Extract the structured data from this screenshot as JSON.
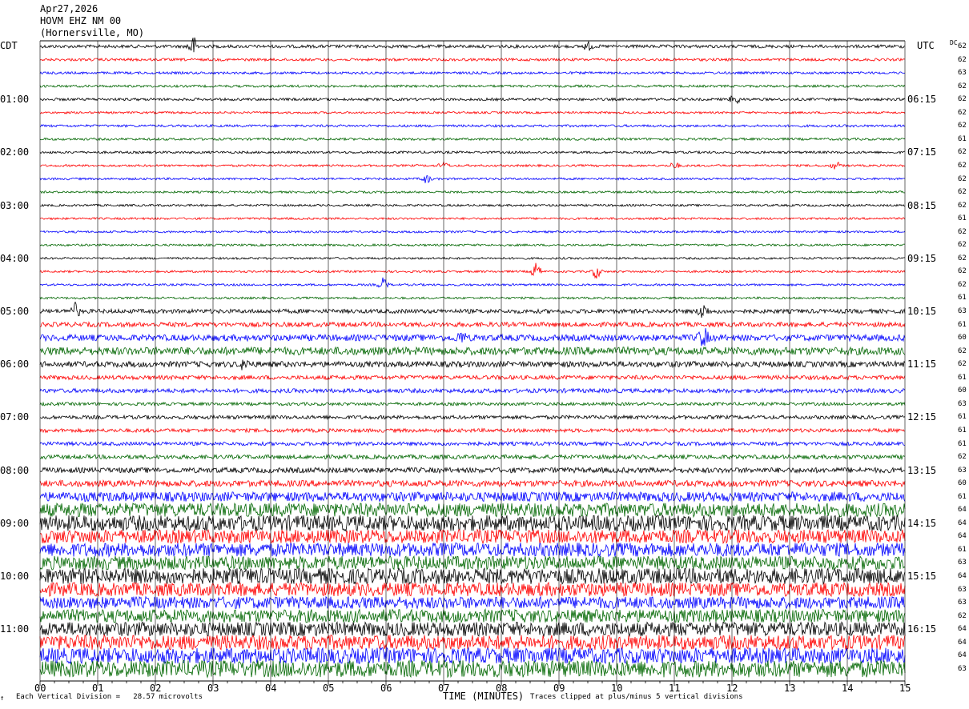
{
  "header": {
    "date": "Apr27,2026",
    "station": "HOVM EHZ NM 00",
    "location": "(Hornersville, MO)"
  },
  "left_tz": "CDT",
  "right_tz": "UTC",
  "dc_header": "DC",
  "footer": {
    "scale_note": "Each Vertical Division =   28.57 microvolts",
    "xlabel": "TIME (MINUTES)",
    "clip_note": "Traces clipped at plus/minus 5 vertical divisions",
    "corner_mark": "↑"
  },
  "colors": {
    "trace_cycle": [
      "#000000",
      "#ff0000",
      "#0000ff",
      "#006600"
    ],
    "grid": "#000000"
  },
  "chart_data": {
    "type": "line",
    "title": "HOVM EHZ NM 00 (Hornersville, MO) helicorder, Apr27,2026",
    "xlabel": "TIME (MINUTES)",
    "xlim": [
      0,
      15
    ],
    "x_ticks": [
      "00",
      "01",
      "02",
      "03",
      "04",
      "05",
      "06",
      "07",
      "08",
      "09",
      "10",
      "11",
      "12",
      "13",
      "14",
      "15"
    ],
    "row_minutes": 15,
    "left_labels": [
      "01:00",
      "02:00",
      "03:00",
      "04:00",
      "05:00",
      "06:00",
      "07:00",
      "08:00",
      "09:00",
      "10:00",
      "11:00"
    ],
    "right_labels": [
      "06:15",
      "07:15",
      "08:15",
      "09:15",
      "10:15",
      "11:15",
      "12:15",
      "13:15",
      "14:15",
      "15:15",
      "16:15"
    ],
    "dc_offsets": [
      "62",
      "62",
      "63",
      "62",
      "62",
      "62",
      "62",
      "61",
      "62",
      "62",
      "62",
      "62",
      "62",
      "61",
      "62",
      "62",
      "62",
      "62",
      "62",
      "61",
      "63",
      "61",
      "60",
      "62",
      "62",
      "61",
      "60",
      "63",
      "61",
      "61",
      "61",
      "62",
      "63",
      "60",
      "61",
      "64",
      "64",
      "64",
      "61",
      "63",
      "64",
      "63",
      "63",
      "62",
      "64",
      "64",
      "64",
      "63"
    ],
    "amplitude_divisions": [
      0.6,
      0.5,
      0.45,
      0.45,
      0.5,
      0.4,
      0.45,
      0.45,
      0.45,
      0.4,
      0.4,
      0.4,
      0.4,
      0.4,
      0.4,
      0.4,
      0.4,
      0.4,
      0.4,
      0.4,
      0.8,
      0.9,
      1.2,
      1.5,
      1.1,
      0.8,
      0.8,
      0.6,
      0.7,
      0.7,
      0.7,
      0.8,
      1.0,
      1.2,
      1.8,
      2.6,
      3.0,
      2.6,
      2.6,
      2.6,
      3.0,
      2.6,
      2.3,
      2.5,
      2.7,
      2.8,
      3.0,
      3.2
    ],
    "events": [
      {
        "row": 0,
        "minute": 2.65,
        "amp": 4
      },
      {
        "row": 0,
        "minute": 9.5,
        "amp": 1.5
      },
      {
        "row": 4,
        "minute": 12.05,
        "amp": 2
      },
      {
        "row": 9,
        "minute": 7.0,
        "amp": 1.2
      },
      {
        "row": 9,
        "minute": 11.0,
        "amp": 1.2
      },
      {
        "row": 9,
        "minute": 13.8,
        "amp": 1.5
      },
      {
        "row": 10,
        "minute": 6.7,
        "amp": 1.6
      },
      {
        "row": 17,
        "minute": 8.6,
        "amp": 3
      },
      {
        "row": 17,
        "minute": 9.65,
        "amp": 2.5
      },
      {
        "row": 18,
        "minute": 5.95,
        "amp": 2.5
      },
      {
        "row": 20,
        "minute": 0.6,
        "amp": 3
      },
      {
        "row": 20,
        "minute": 11.5,
        "amp": 3
      },
      {
        "row": 22,
        "minute": 11.5,
        "amp": 4
      },
      {
        "row": 22,
        "minute": 7.3,
        "amp": 2
      },
      {
        "row": 24,
        "minute": 3.55,
        "amp": 2
      }
    ],
    "scale_microvolts_per_division": 28.57,
    "clip_divisions": 5
  }
}
